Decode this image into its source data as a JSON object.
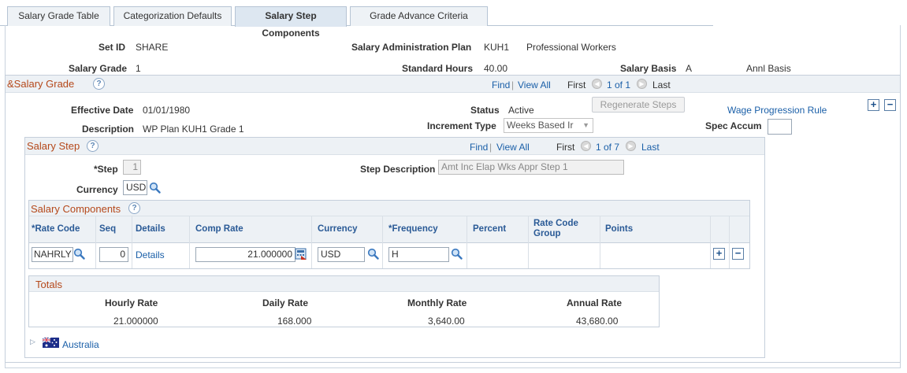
{
  "tabs": [
    {
      "label": "Salary Grade Table",
      "active": false
    },
    {
      "label": "Categorization Defaults",
      "active": false
    },
    {
      "label": "Salary Step Components",
      "active": true
    },
    {
      "label": "Grade Advance Criteria",
      "active": false
    }
  ],
  "header": {
    "setid_label": "Set ID",
    "setid_value": "SHARE",
    "plan_label": "Salary Administration Plan",
    "plan_value": "KUH1",
    "plan_desc": "Professional Workers",
    "grade_label": "Salary Grade",
    "grade_value": "1",
    "std_hours_label": "Standard Hours",
    "std_hours_value": "40.00",
    "basis_label": "Salary Basis",
    "basis_value": "A",
    "basis_desc": "Annl Basis"
  },
  "salary_grade": {
    "title": "&Salary Grade",
    "find": "Find",
    "sep": "|",
    "view_all": "View All",
    "first": "First",
    "pager": "1 of 1",
    "last": "Last",
    "effdt_label": "Effective Date",
    "effdt_value": "01/01/1980",
    "status_label": "Status",
    "status_value": "Active",
    "regen_button": "Regenerate Steps",
    "wage_rule_link": "Wage Progression Rule",
    "desc_label": "Description",
    "desc_value": "WP Plan KUH1 Grade 1",
    "increment_label": "Increment Type",
    "increment_value": "Weeks Based Ir",
    "spec_accum_label": "Spec Accum"
  },
  "salary_step": {
    "title": "Salary Step",
    "find": "Find",
    "sep": "|",
    "view_all": "View All",
    "first": "First",
    "pager": "1 of 7",
    "last": "Last",
    "step_label": "*Step",
    "step_value": "1",
    "step_desc_label": "Step Description",
    "step_desc_value": "Amt Inc Elap Wks Appr Step 1",
    "currency_label": "Currency",
    "currency_value": "USD"
  },
  "components": {
    "title": "Salary Components",
    "columns": [
      "*Rate Code",
      "Seq",
      "Details",
      "Comp Rate",
      "Currency",
      "*Frequency",
      "Percent",
      "Rate Code Group",
      "Points"
    ],
    "row": {
      "rate_code": "NAHRLY",
      "seq": "0",
      "details": "Details",
      "comp_rate": "21.000000",
      "currency": "USD",
      "frequency": "H"
    }
  },
  "totals": {
    "title": "Totals",
    "labels": [
      "Hourly Rate",
      "Daily Rate",
      "Monthly Rate",
      "Annual Rate"
    ],
    "values": [
      "21.000000",
      "168.000",
      "3,640.00",
      "43,680.00"
    ]
  },
  "country": {
    "label": "Australia"
  },
  "colors": {
    "accent_title": "#b5481a",
    "link": "#1a5fa8",
    "header_bg": "#edf1f5"
  }
}
